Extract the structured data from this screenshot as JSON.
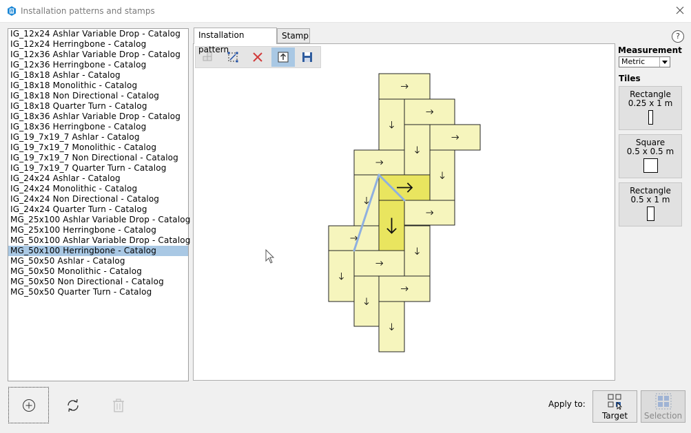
{
  "window": {
    "title": "Installation patterns and stamps"
  },
  "patterns": [
    "IG_12x24 Ashlar Variable Drop - Catalog",
    "IG_12x24 Herringbone - Catalog",
    "IG_12x36 Ashlar Variable Drop - Catalog",
    "IG_12x36 Herringbone - Catalog",
    "IG_18x18 Ashlar - Catalog",
    "IG_18x18 Monolithic - Catalog",
    "IG_18x18 Non Directional - Catalog",
    "IG_18x18 Quarter Turn - Catalog",
    "IG_18x36 Ashlar Variable Drop - Catalog",
    "IG_18x36 Herringbone - Catalog",
    "IG_19_7x19_7 Ashlar - Catalog",
    "IG_19_7x19_7 Monolithic - Catalog",
    "IG_19_7x19_7 Non Directional - Catalog",
    "IG_19_7x19_7 Quarter Turn - Catalog",
    "IG_24x24 Ashlar - Catalog",
    "IG_24x24 Monolithic - Catalog",
    "IG_24x24 Non Directional - Catalog",
    "IG_24x24 Quarter Turn - Catalog",
    "MG_25x100 Ashlar Variable Drop - Catalog",
    "MG_25x100 Herringbone - Catalog",
    "MG_50x100 Ashlar Variable Drop - Catalog",
    "MG_50x100 Herringbone - Catalog",
    "MG_50x50 Ashlar - Catalog",
    "MG_50x50 Monolithic - Catalog",
    "MG_50x50 Non Directional - Catalog",
    "MG_50x50 Quarter Turn - Catalog"
  ],
  "selected_pattern": "MG_50x100 Herringbone - Catalog",
  "tabs": {
    "installation": "Installation pattern",
    "stamp": "Stamp",
    "active": "installation"
  },
  "help": "?",
  "toolbar": {
    "buttons": [
      {
        "icon": "tiles-grid-icon",
        "enabled": false
      },
      {
        "icon": "node-edit-icon",
        "enabled": true
      },
      {
        "icon": "delete-x-icon",
        "enabled": true
      },
      {
        "icon": "upload-icon",
        "enabled": true,
        "active": true
      },
      {
        "icon": "save-icon",
        "enabled": true
      }
    ]
  },
  "measurement": {
    "label": "Measurement",
    "value": "Metric"
  },
  "tiles": {
    "label": "Tiles",
    "items": [
      {
        "name": "Rectangle",
        "size": "0.25 x 1 m"
      },
      {
        "name": "Square",
        "size": "0.5 x 0.5 m"
      },
      {
        "name": "Rectangle",
        "size": "0.5 x 1 m"
      }
    ]
  },
  "bottom": {
    "apply_to": "Apply to:",
    "target": "Target",
    "selection": "Selection"
  },
  "colors": {
    "tile": "#f6f5bd",
    "tile_highlight": "#e9e55f",
    "selection": "#a9c8e4",
    "line": "#8fb0e0"
  }
}
